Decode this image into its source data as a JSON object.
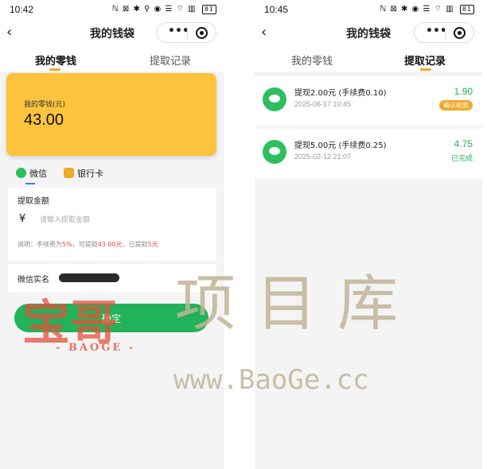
{
  "left": {
    "status": {
      "time": "10:42",
      "icons": "ℕ ⊠ ✱ ⚲ ◉ ☰ ⌔ ▥",
      "battery": "81"
    },
    "navbar": {
      "title": "我的钱袋",
      "more": "•••"
    },
    "tabs": [
      {
        "label": "我的零钱",
        "active": true
      },
      {
        "label": "提取记录",
        "active": false
      }
    ],
    "balance": {
      "label": "我的零钱(元)",
      "amount": "43.00"
    },
    "methods": [
      {
        "label": "微信",
        "icon": "wechat-icon",
        "active": true
      },
      {
        "label": "银行卡",
        "icon": "bank-card-icon",
        "active": false
      }
    ],
    "form": {
      "title": "提取金额",
      "currency": "¥",
      "placeholder": "请输入提取金额",
      "note_prefix": "说明：手续费为",
      "fee_rate": "5%",
      "note_mid": "，可提取",
      "available": "43.00元",
      "note_mid2": "，已提取",
      "withdrawn": "5元"
    },
    "realname": {
      "label": "微信实名"
    },
    "confirm_label": "确定"
  },
  "right": {
    "status": {
      "time": "10:45",
      "icons": "ℕ ⊠ ✱ ◉ ☰ ⌔ ▥",
      "battery": "81"
    },
    "navbar": {
      "title": "我的钱袋",
      "more": "•••"
    },
    "tabs": [
      {
        "label": "我的零钱",
        "active": false
      },
      {
        "label": "提取记录",
        "active": true
      }
    ],
    "records": [
      {
        "title": "提现2.00元 (手续费0.10)",
        "date": "2025-06-17 10:45",
        "amount": "1.90",
        "status": "确认收款",
        "status_style": "pill"
      },
      {
        "title": "提现5.00元 (手续费0.25)",
        "date": "2025-02-12 21:07",
        "amount": "4.75",
        "status": "已完成",
        "status_style": "text"
      }
    ]
  },
  "watermark": {
    "logo": "宝哥",
    "logo_sub": "- BAOGE -",
    "text": "项目库",
    "url": "www.BaoGe.cc"
  },
  "colors": {
    "accent": "#f5a623",
    "card": "#fcc33c",
    "green": "#22b35a",
    "wechat": "#2dbe60",
    "highlight": "#e64b3c"
  }
}
